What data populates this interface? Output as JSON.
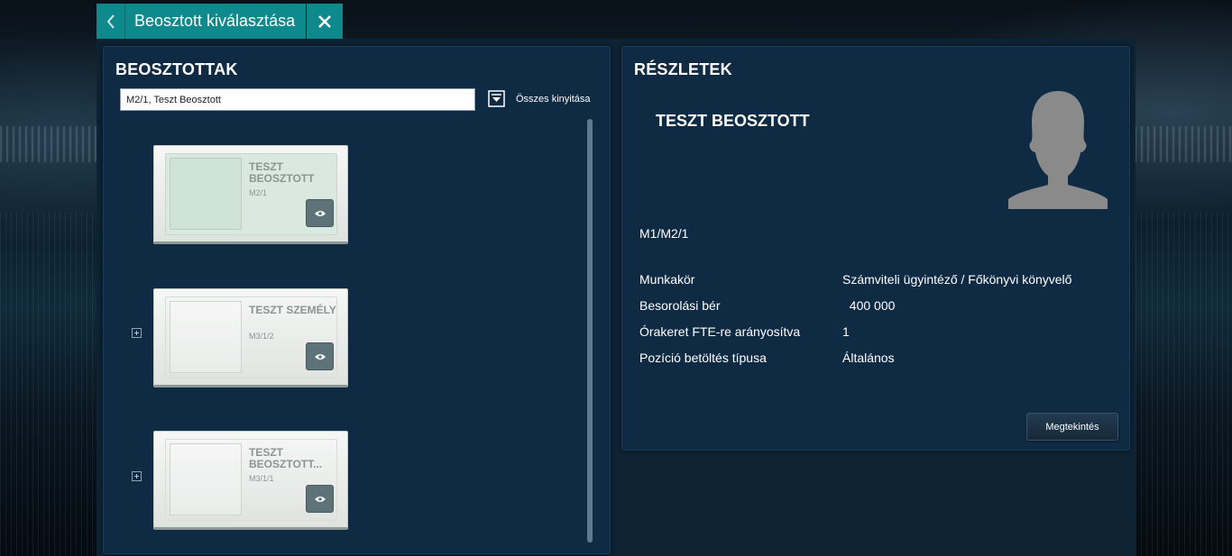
{
  "topbar": {
    "title": "Beosztott kiválasztása",
    "back_icon": "chevron-left-icon",
    "close_icon": "close-icon",
    "accent": "#0f8a8c"
  },
  "left_panel": {
    "title": "BEOSZTOTTAK",
    "search": {
      "value": "M2/1, Teszt Beosztott",
      "placeholder": ""
    },
    "expand_all_label": "Összes kinyitása",
    "cards": [
      {
        "name": "TESZT BEOSZTOTT",
        "code": "M2/1",
        "selected": true,
        "expandable": false
      },
      {
        "name": "TESZT SZEMÉLY",
        "code": "M3/1/2",
        "selected": false,
        "expandable": true
      },
      {
        "name": "TESZT BEOSZTOTT...",
        "code": "M3/1/1",
        "selected": false,
        "expandable": true
      }
    ]
  },
  "right_panel": {
    "title": "RÉSZLETEK",
    "name": "TESZT BEOSZTOTT",
    "code": "M1/M2/1",
    "details": [
      {
        "label": "Munkakör",
        "value": "Számviteli ügyintéző / Főkönyvi könyvelő"
      },
      {
        "label": "Besorolási bér",
        "value": "  400 000"
      },
      {
        "label": "Órakeret FTE-re arányosítva",
        "value": "1"
      },
      {
        "label": "Pozíció betöltés típusa",
        "value": "Általános"
      }
    ],
    "view_button_label": "Megtekintés"
  }
}
